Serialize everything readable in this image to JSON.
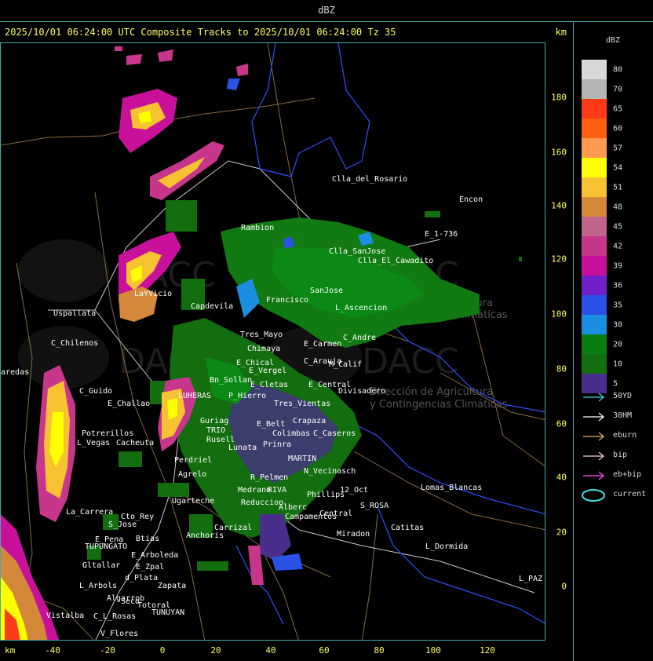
{
  "top_title": "dBZ",
  "header": {
    "text": "2025/10/01 06:24:00 UTC Composite Tracks to 2025/10/01 06:24:00 Tz 35",
    "unit": "km"
  },
  "y_axis": {
    "ticks": [
      "180",
      "160",
      "140",
      "120",
      "100",
      "80",
      "60",
      "40",
      "20",
      "0"
    ]
  },
  "x_axis": {
    "unit_label": "km",
    "ticks": [
      "-40",
      "-20",
      "0",
      "20",
      "40",
      "60",
      "80",
      "100",
      "120"
    ]
  },
  "legend": {
    "title": "dBZ",
    "items": [
      {
        "label": "80",
        "color": "#d8d8d8"
      },
      {
        "label": "70",
        "color": "#b4b4b4"
      },
      {
        "label": "65",
        "color": "#ff3a1a"
      },
      {
        "label": "60",
        "color": "#ff6010"
      },
      {
        "label": "57",
        "color": "#ff9a50"
      },
      {
        "label": "54",
        "color": "#ffff00"
      },
      {
        "label": "51",
        "color": "#f6c231"
      },
      {
        "label": "48",
        "color": "#d4883a"
      },
      {
        "label": "45",
        "color": "#c0648c"
      },
      {
        "label": "42",
        "color": "#c8368c"
      },
      {
        "label": "39",
        "color": "#c8109a"
      },
      {
        "label": "36",
        "color": "#7020c8"
      },
      {
        "label": "35",
        "color": "#2a52e6"
      },
      {
        "label": "30",
        "color": "#1a8ee0"
      },
      {
        "label": "20",
        "color": "#0a7e10"
      },
      {
        "label": "10",
        "color": "#126e0e"
      },
      {
        "label": "5",
        "color": "#4a2e8c"
      }
    ]
  },
  "tracks": [
    {
      "label": "50YD",
      "color": "#40d8d8",
      "icon": "arrow-right-icon"
    },
    {
      "label": "30HM",
      "color": "#ffffff",
      "icon": "arrow-right-icon"
    },
    {
      "label": "eburn",
      "color": "#e8b060",
      "icon": "arrow-right-icon"
    },
    {
      "label": "bip",
      "color": "#ffd0d0",
      "icon": "arrow-right-icon"
    },
    {
      "label": "eb+bip",
      "color": "#ff50ff",
      "icon": "arrow-right-icon"
    },
    {
      "label": "current",
      "color": "#40e0e0",
      "icon": "ellipse-icon"
    }
  ],
  "watermarks": [
    {
      "brand": "DACC",
      "subtitle": "Dirección de Agricultura",
      "subtitle2": "y Contingencias Climáticas"
    }
  ],
  "places": [
    "Clla_del_Rosario",
    "Encon",
    "E_1-736",
    "Rambion",
    "Clla_SanJose",
    "Clla_El_Cawadito",
    "Uspallata",
    "LaYVicio",
    "Capdevila",
    "Francisco",
    "SanJose",
    "L_Ascencion",
    "C_Chilenos",
    "Tres_Mayo",
    "Chimaya",
    "E_Carmen",
    "C_Andre",
    "C_Arauja",
    "M_Calif",
    "aredas",
    "E_Chical",
    "E_Vergel",
    "Bn_Sollan",
    "E_Cletas",
    "E_Central",
    "Divisadero",
    "C_Guido",
    "LUHERAS",
    "P_Hierro",
    "Tres_Vientas",
    "E_Challao",
    "Crapaza",
    "Guriag",
    "TRIO",
    "E_Belt",
    "Colimbas",
    "C_Caseros",
    "Potrerillos",
    "L_Vegas",
    "Cacheuta",
    "Rusell",
    "Lunata",
    "Prinra",
    "MARTIN",
    "Perdriel",
    "Agrelo",
    "R_Pelmen",
    "N_Vecinasch",
    "Ugarteche",
    "Medrano",
    "RIVA",
    "Phillips",
    "12_Oct",
    "Reduccion",
    "Alberc",
    "S_ROSA",
    "Lomas_Blancas",
    "La_Carrera",
    "Cto_Rey",
    "S_Jose",
    "Carrizal",
    "Campamentos",
    "Central",
    "Catitas",
    "E_Pena",
    "Btias",
    "Anchoris",
    "TUPUNGATO",
    "E_Arboleda",
    "Miradon",
    "L_Dormida",
    "Gltallar",
    "E_Zpal",
    "d_Plata",
    "L_Arbols",
    "Zapata",
    "Algarrob",
    "Seco",
    "Totoral",
    "TUNUYAN",
    "C_L_Rosas",
    "Vistalba",
    "V_Flores",
    "L_PAZ"
  ]
}
